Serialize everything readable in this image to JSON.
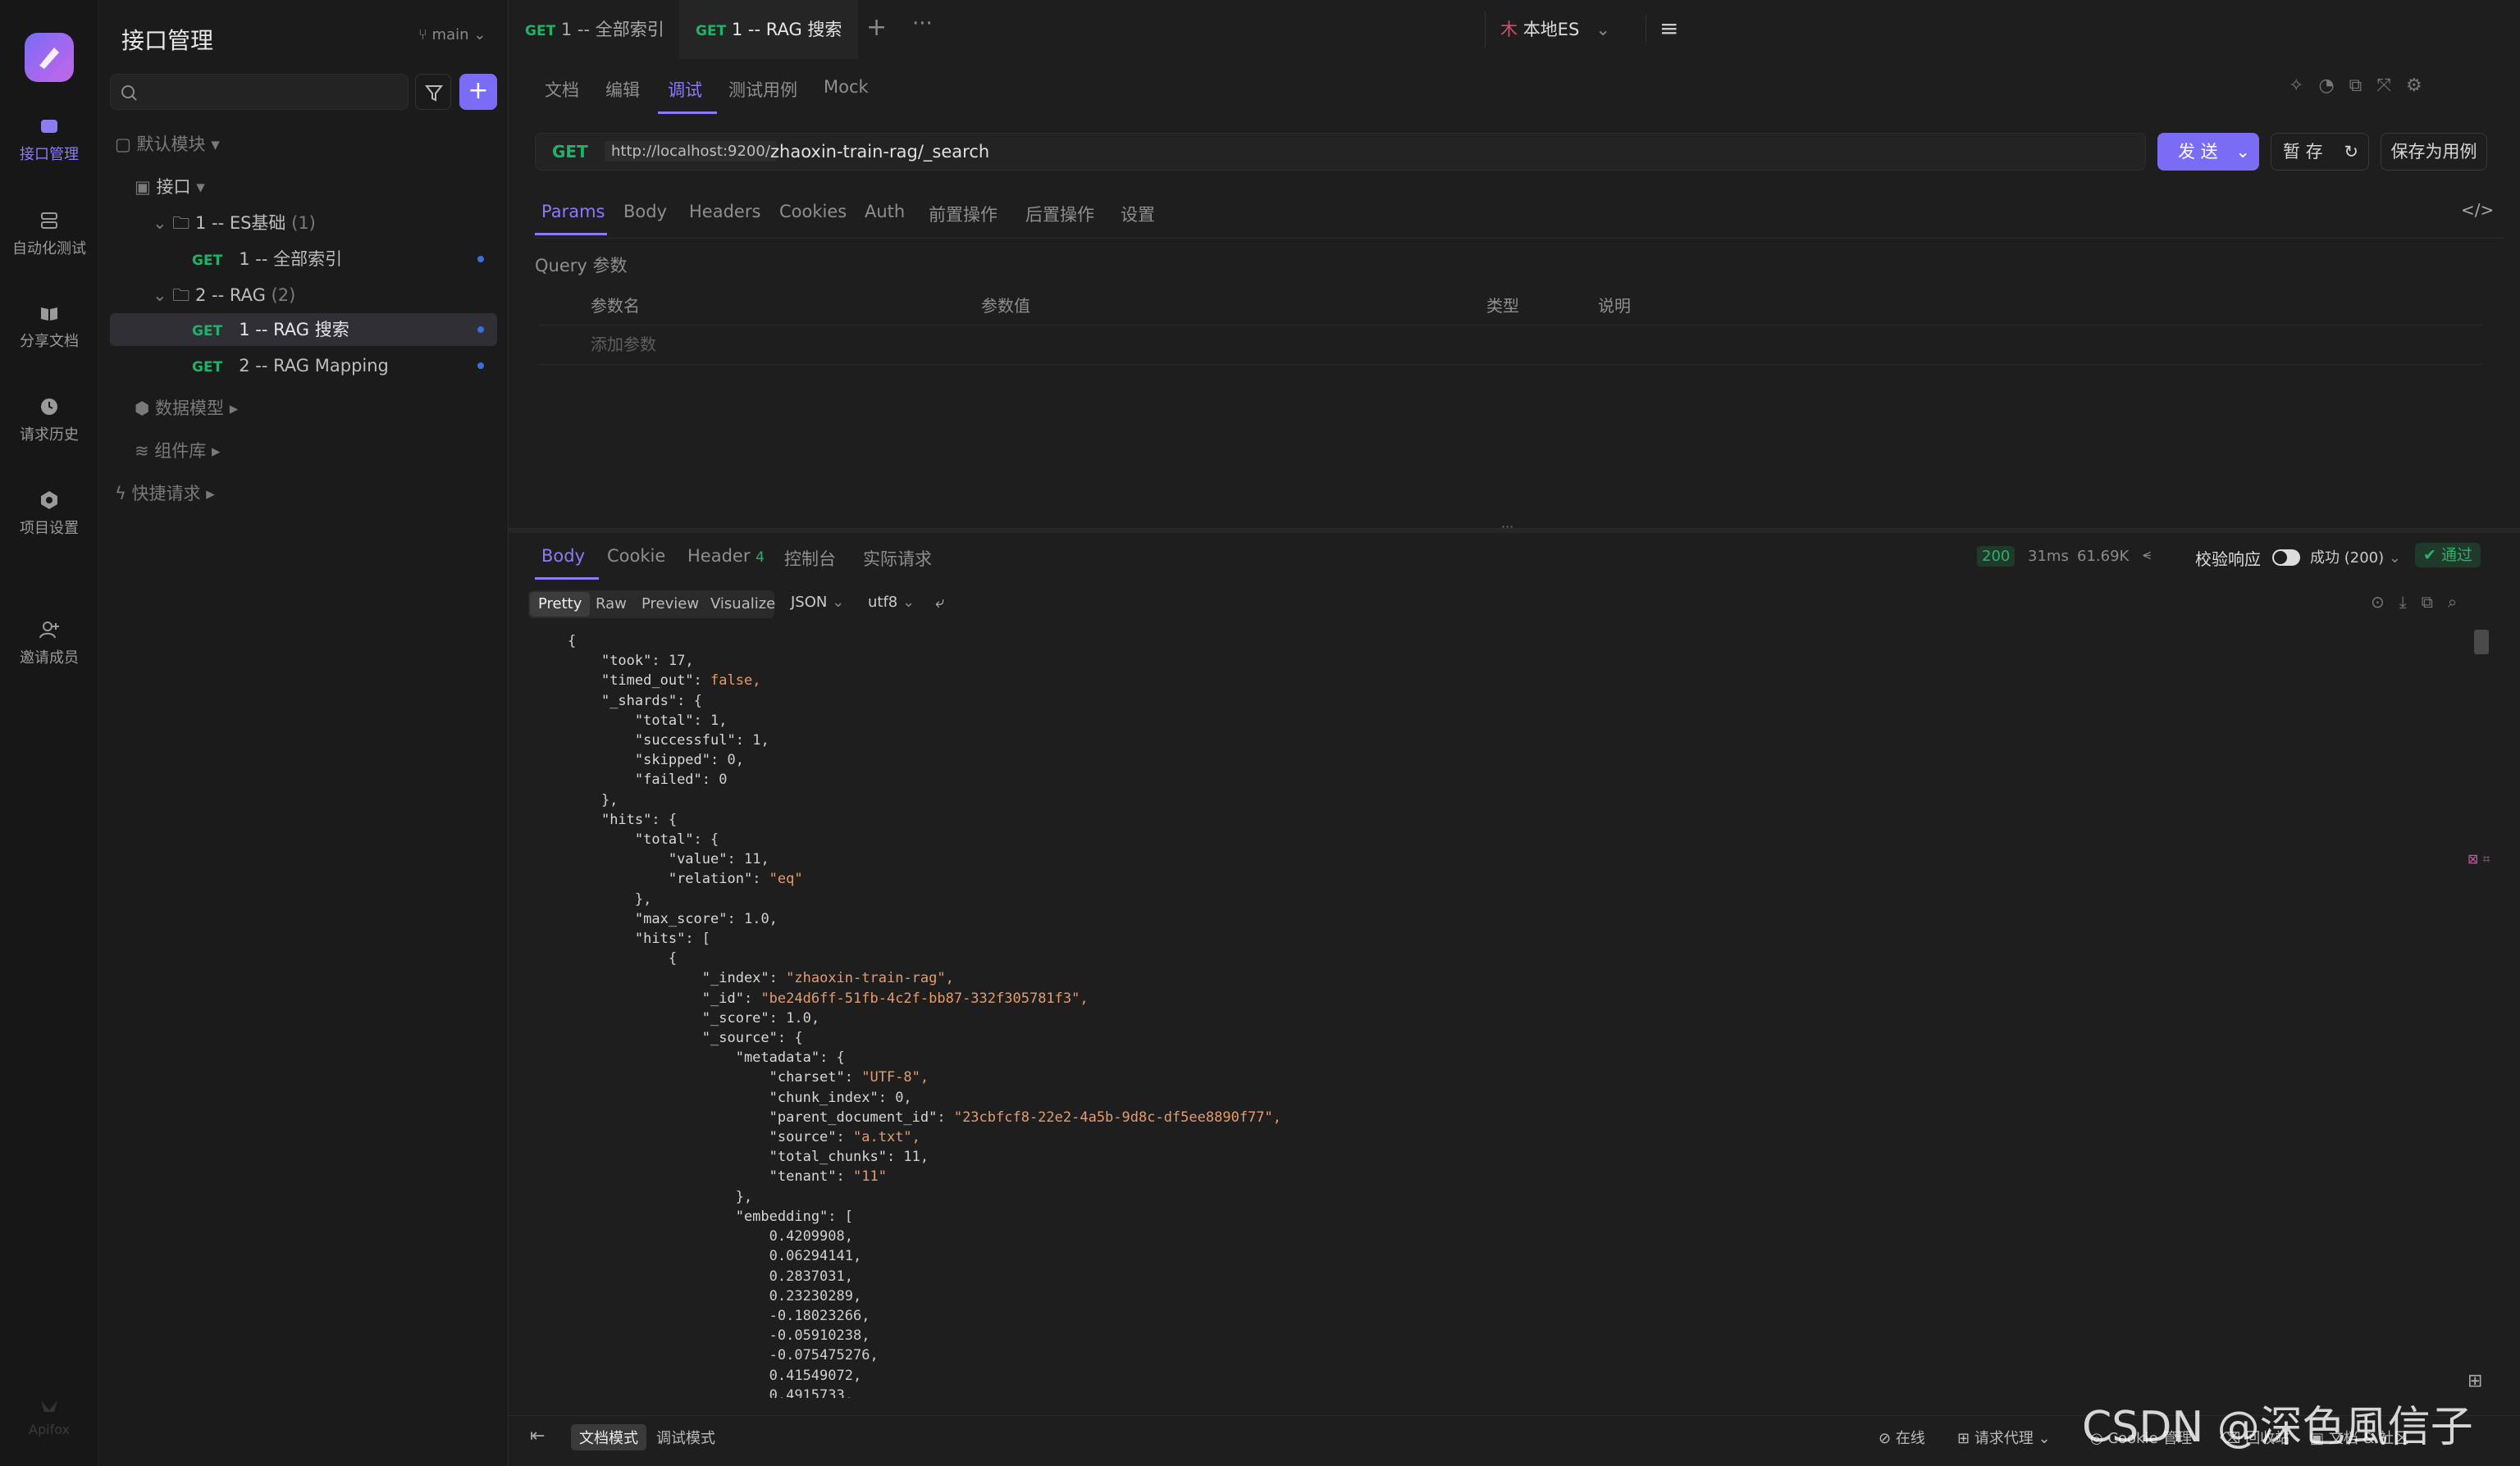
{
  "rail": {
    "items": [
      {
        "label": "接口管理",
        "icon": "api-icon"
      },
      {
        "label": "自动化测试",
        "icon": "automation-icon"
      },
      {
        "label": "分享文档",
        "icon": "share-doc-icon"
      },
      {
        "label": "请求历史",
        "icon": "history-icon"
      },
      {
        "label": "项目设置",
        "icon": "settings-icon"
      },
      {
        "label": "邀请成员",
        "icon": "invite-icon"
      }
    ],
    "footer": "Apifox"
  },
  "sidebar": {
    "title": "接口管理",
    "branch": "main",
    "tree": {
      "default_module": "默认模块",
      "api_root": "接口",
      "folder1": {
        "name": "1 -- ES基础",
        "count": "(1)"
      },
      "item1": {
        "method": "GET",
        "name": "1 -- 全部索引"
      },
      "folder2": {
        "name": "2 -- RAG",
        "count": "(2)"
      },
      "item2": {
        "method": "GET",
        "name": "1 -- RAG 搜索"
      },
      "item3": {
        "method": "GET",
        "name": "2 -- RAG Mapping"
      },
      "data_model": "数据模型",
      "components": "组件库",
      "quick": "快捷请求"
    }
  },
  "tabs": [
    {
      "method": "GET",
      "name": "1 -- 全部索引"
    },
    {
      "method": "GET",
      "name": "1 -- RAG 搜索"
    }
  ],
  "env": "本地ES",
  "subtabs": [
    "文档",
    "编辑",
    "调试",
    "测试用例",
    "Mock"
  ],
  "request": {
    "method": "GET",
    "base": "http://localhost:9200/",
    "path": "zhaoxin-train-rag/_search",
    "send": "发 送",
    "save_temp": "暂 存",
    "save_case": "保存为用例"
  },
  "param_tabs": [
    "Params",
    "Body",
    "Headers",
    "Cookies",
    "Auth",
    "前置操作",
    "后置操作",
    "设置"
  ],
  "query": {
    "label": "Query 参数",
    "cols": [
      "参数名",
      "参数值",
      "类型",
      "说明"
    ],
    "add": "添加参数"
  },
  "response": {
    "tabs": [
      "Body",
      "Cookie",
      "Header",
      "控制台",
      "实际请求"
    ],
    "header_count": "4",
    "status": "200",
    "time": "31ms",
    "size": "61.69K",
    "validate": "校验响应",
    "result": "成功 (200)",
    "pass": "通过",
    "views": [
      "Pretty",
      "Raw",
      "Preview",
      "Visualize"
    ],
    "format": "JSON",
    "encoding": "utf8"
  },
  "code_lines": [
    "{",
    "    \"took\": 17,",
    "    \"timed_out\": false,",
    "    \"_shards\": {",
    "        \"total\": 1,",
    "        \"successful\": 1,",
    "        \"skipped\": 0,",
    "        \"failed\": 0",
    "    },",
    "    \"hits\": {",
    "        \"total\": {",
    "            \"value\": 11,",
    "            \"relation\": \"eq\"",
    "        },",
    "        \"max_score\": 1.0,",
    "        \"hits\": [",
    "            {",
    "                \"_index\": \"zhaoxin-train-rag\",",
    "                \"_id\": \"be24d6ff-51fb-4c2f-bb87-332f305781f3\",",
    "                \"_score\": 1.0,",
    "                \"_source\": {",
    "                    \"metadata\": {",
    "                        \"charset\": \"UTF-8\",",
    "                        \"chunk_index\": 0,",
    "                        \"parent_document_id\": \"23cbfcf8-22e2-4a5b-9d8c-df5ee8890f77\",",
    "                        \"source\": \"a.txt\",",
    "                        \"total_chunks\": 11,",
    "                        \"tenant\": \"11\"",
    "                    },",
    "                    \"embedding\": [",
    "                        0.4209908,",
    "                        0.06294141,",
    "                        0.2837031,",
    "                        0.23230289,",
    "                        -0.18023266,",
    "                        -0.05910238,",
    "                        -0.075475276,",
    "                        0.41549072,",
    "                        0.4915733,"
  ],
  "bottom": {
    "doc_mode": "文档模式",
    "debug_mode": "调试模式",
    "online": "在线",
    "proxy": "请求代理",
    "cookie": "Cookie 管理",
    "recycle": "回收站",
    "docs": "文档 & 社区"
  },
  "watermark": "CSDN @深色風信子",
  "colors": {
    "accent": "#8b7cf6",
    "get": "#20b26b",
    "success": "#2fb06a",
    "string": "#e29c71"
  }
}
